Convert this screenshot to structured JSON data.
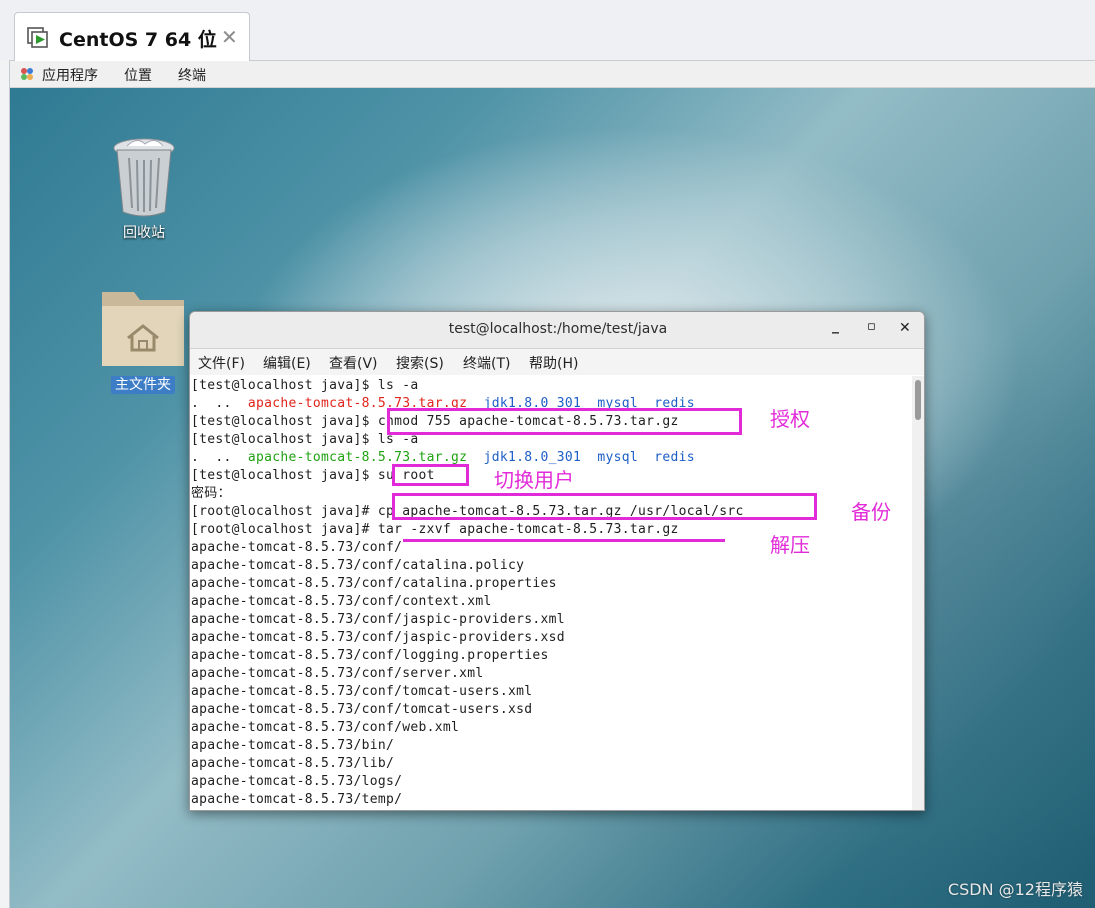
{
  "vm_tab": {
    "title": "CentOS 7 64 位",
    "close": "✕"
  },
  "gnome_menu": {
    "applications": "应用程序",
    "places": "位置",
    "terminal": "终端"
  },
  "desktop": {
    "trash_label": "回收站",
    "home_label": "主文件夹"
  },
  "terminal": {
    "title": "test@localhost:/home/test/java",
    "minimize": "_",
    "maximize": "▫",
    "close": "✕",
    "menu": [
      "文件(F)",
      "编辑(E)",
      "查看(V)",
      "搜索(S)",
      "终端(T)",
      "帮助(H)"
    ],
    "lines": {
      "l1": "[test@localhost java]$ ls -a",
      "l2_dots": ".  ..  ",
      "l2_tar": "apache-tomcat-8.5.73.tar.gz",
      "l2_jdk": "jdk1.8.0_301",
      "l2_mysql": "mysql",
      "l2_redis": "redis",
      "l3": "[test@localhost java]$ chmod 755 apache-tomcat-8.5.73.tar.gz",
      "l4": "[test@localhost java]$ ls -a",
      "l5_dots": ".  ..  ",
      "l5_tar": "apache-tomcat-8.5.73.tar.gz",
      "l5_jdk": "jdk1.8.0_301",
      "l5_mysql": "mysql",
      "l5_redis": "redis",
      "l6": "[test@localhost java]$ su root",
      "l7": "密码：",
      "l8": "[root@localhost java]# cp apache-tomcat-8.5.73.tar.gz /usr/local/src",
      "l9": "[root@localhost java]# tar -zxvf apache-tomcat-8.5.73.tar.gz"
    },
    "extract_output": [
      "apache-tomcat-8.5.73/conf/",
      "apache-tomcat-8.5.73/conf/catalina.policy",
      "apache-tomcat-8.5.73/conf/catalina.properties",
      "apache-tomcat-8.5.73/conf/context.xml",
      "apache-tomcat-8.5.73/conf/jaspic-providers.xml",
      "apache-tomcat-8.5.73/conf/jaspic-providers.xsd",
      "apache-tomcat-8.5.73/conf/logging.properties",
      "apache-tomcat-8.5.73/conf/server.xml",
      "apache-tomcat-8.5.73/conf/tomcat-users.xml",
      "apache-tomcat-8.5.73/conf/tomcat-users.xsd",
      "apache-tomcat-8.5.73/conf/web.xml",
      "apache-tomcat-8.5.73/bin/",
      "apache-tomcat-8.5.73/lib/",
      "apache-tomcat-8.5.73/logs/",
      "apache-tomcat-8.5.73/temp/"
    ]
  },
  "annotations": {
    "authorize": "授权",
    "switch_user": "切换用户",
    "backup": "备份",
    "extract": "解压"
  },
  "watermark": "CSDN @12程序猿",
  "colors": {
    "annotation": "#e22bd8",
    "archive": "#e0241b",
    "directory": "#1c5ec6",
    "executable_archive": "#1fa312"
  }
}
